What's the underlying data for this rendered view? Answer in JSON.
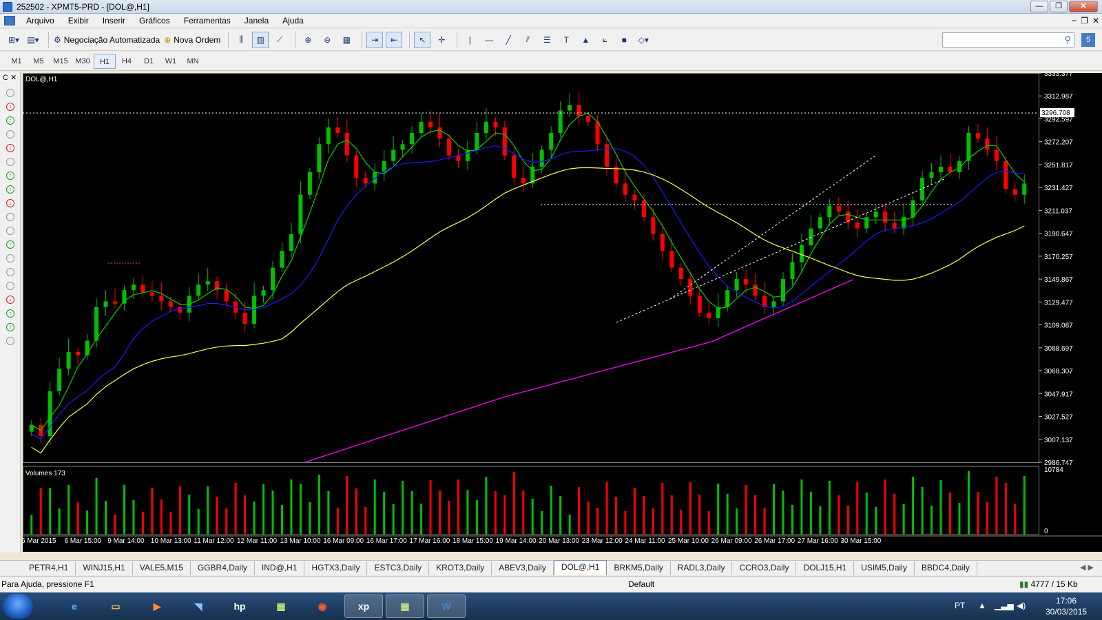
{
  "window": {
    "title": "252502 - XPMT5-PRD - [DOL@,H1]"
  },
  "menu": [
    "Arquivo",
    "Exibir",
    "Inserir",
    "Gráficos",
    "Ferramentas",
    "Janela",
    "Ajuda"
  ],
  "toolbar": {
    "auto_trading_label": "Negociação Automatizada",
    "new_order_label": "Nova Ordem"
  },
  "timeframes": [
    "M1",
    "M5",
    "M15",
    "M30",
    "H1",
    "H4",
    "D1",
    "W1",
    "MN"
  ],
  "active_timeframe": "H1",
  "chart": {
    "symbol_label": "DOL@,H1",
    "volumes_label": "Volumes 173",
    "current_price_label": "3296.708",
    "price_ticks": [
      "3333.377",
      "3312.987",
      "3292.597",
      "3272.207",
      "3251.817",
      "3231.427",
      "3211.037",
      "3190.647",
      "3170.257",
      "3149.867",
      "3129.477",
      "3109.087",
      "3088.697",
      "3068.307",
      "3047.917",
      "3027.527",
      "3007.137",
      "2986.747"
    ],
    "volume_ticks": [
      "10784",
      "0"
    ],
    "time_ticks": [
      "5 Mar 2015",
      "6 Mar 15:00",
      "9 Mar 14:00",
      "10 Mar 13:00",
      "11 Mar 12:00",
      "12 Mar 11:00",
      "13 Mar 10:00",
      "16 Mar 09:00",
      "16 Mar 17:00",
      "17 Mar 16:00",
      "18 Mar 15:00",
      "19 Mar 14:00",
      "20 Mar 13:00",
      "23 Mar 12:00",
      "24 Mar 11:00",
      "25 Mar 10:00",
      "26 Mar 09:00",
      "26 Mar 17:00",
      "27 Mar 16:00",
      "30 Mar 15:00"
    ],
    "colors": {
      "bull": "#00c000",
      "bear": "#ff0000",
      "ma_fast": "#00d000",
      "ma_mid": "#1a1aff",
      "ma_slow": "#ffff40",
      "ma_long": "#ff00ff",
      "grid_line": "#ffffff"
    }
  },
  "chart_data": {
    "type": "candlestick",
    "symbol": "DOL@,H1",
    "close_series_approx": [
      3020,
      3010,
      3050,
      3070,
      3085,
      3082,
      3095,
      3125,
      3130,
      3128,
      3140,
      3145,
      3138,
      3135,
      3130,
      3125,
      3120,
      3135,
      3145,
      3148,
      3140,
      3130,
      3120,
      3110,
      3135,
      3140,
      3160,
      3175,
      3190,
      3225,
      3245,
      3270,
      3285,
      3280,
      3260,
      3240,
      3235,
      3245,
      3255,
      3265,
      3270,
      3280,
      3290,
      3285,
      3275,
      3260,
      3255,
      3265,
      3280,
      3290,
      3285,
      3260,
      3240,
      3235,
      3250,
      3265,
      3280,
      3300,
      3305,
      3295,
      3290,
      3270,
      3250,
      3235,
      3225,
      3220,
      3205,
      3190,
      3175,
      3160,
      3150,
      3135,
      3120,
      3115,
      3125,
      3140,
      3150,
      3145,
      3135,
      3125,
      3130,
      3150,
      3165,
      3180,
      3195,
      3205,
      3215,
      3210,
      3200,
      3195,
      3205,
      3210,
      3200,
      3195,
      3205,
      3220,
      3240,
      3245,
      3250,
      3245,
      3255,
      3280,
      3275,
      3265,
      3255,
      3230,
      3225,
      3235
    ],
    "y_range": [
      2986.747,
      3333.377
    ],
    "volume_range": [
      0,
      10784
    ]
  },
  "tabs": [
    "PETR4,H1",
    "WINJ15,H1",
    "VALE5,M15",
    "GGBR4,Daily",
    "IND@,H1",
    "HGTX3,Daily",
    "ESTC3,Daily",
    "KROT3,Daily",
    "ABEV3,Daily",
    "DOL@,H1",
    "BRKM5,Daily",
    "RADL3,Daily",
    "CCRO3,Daily",
    "DOLJ15,H1",
    "USIM5,Daily",
    "BBDC4,Daily"
  ],
  "active_tab": "DOL@,H1",
  "status": {
    "help": "Para Ajuda, pressione F1",
    "profile": "Default",
    "connection": "4777 / 15 Kb"
  },
  "taskbar": {
    "lang": "PT",
    "time": "17:06",
    "date": "30/03/2015",
    "xp_label": "xp"
  }
}
